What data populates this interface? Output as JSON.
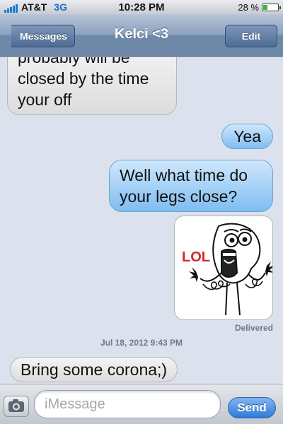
{
  "status_bar": {
    "carrier": "AT&T",
    "network": "3G",
    "time": "10:28 PM",
    "battery_percent": "28 %",
    "battery_level": 0.28,
    "signal_bars": 5,
    "signal_color": "#1b7bd6"
  },
  "nav": {
    "back_label": "Messages",
    "title": "Kelci <3",
    "edit_label": "Edit"
  },
  "messages": [
    {
      "direction": "received",
      "text": "probably will be closed by the time your off"
    },
    {
      "direction": "sent",
      "text": "Yea"
    },
    {
      "direction": "sent",
      "text": "Well what time do your legs close?"
    },
    {
      "direction": "sent",
      "type": "image",
      "image_caption": "LOL"
    },
    {
      "direction": "received",
      "text": "Bring some corona;)"
    }
  ],
  "delivered_label": "Delivered",
  "timestamp": "Jul 18, 2012 9:43 PM",
  "input": {
    "placeholder": "iMessage",
    "send_label": "Send"
  },
  "colors": {
    "sent_bubble": "#7fbdf1",
    "received_bubble": "#dcdcdc",
    "lol_text": "#d62828",
    "background": "#dbe2ed"
  }
}
